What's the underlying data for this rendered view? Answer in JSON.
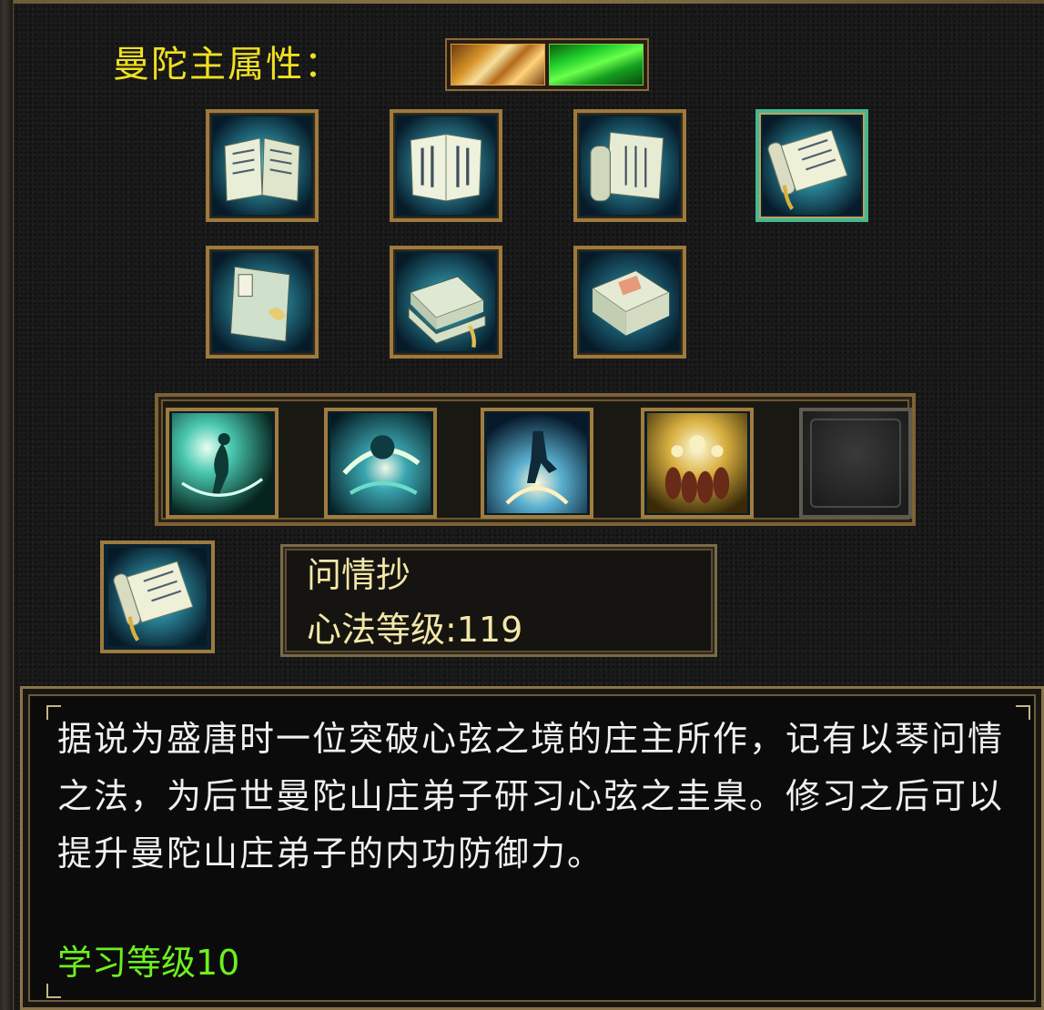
{
  "attributes": {
    "label": "曼陀主属性：",
    "elements": [
      {
        "name": "thunder-element-icon",
        "color": "#d9962a"
      },
      {
        "name": "wood-element-icon",
        "color": "#1fcf2a"
      }
    ]
  },
  "books": [
    {
      "icon": "open-book-icon",
      "selected": false
    },
    {
      "icon": "open-scripture-icon",
      "selected": false
    },
    {
      "icon": "scroll-with-book-icon",
      "selected": false
    },
    {
      "icon": "scroll-icon",
      "selected": true
    },
    {
      "icon": "closed-manual-icon",
      "selected": false
    },
    {
      "icon": "stacked-books-icon",
      "selected": false
    },
    {
      "icon": "boxed-book-icon",
      "selected": false
    }
  ],
  "skills": [
    {
      "icon": "wind-spin-skill-icon",
      "empty": false
    },
    {
      "icon": "wave-slash-skill-icon",
      "empty": false
    },
    {
      "icon": "leap-burst-skill-icon",
      "empty": false
    },
    {
      "icon": "flame-summon-skill-icon",
      "empty": false
    },
    {
      "icon": "empty-skill-slot-icon",
      "empty": true
    }
  ],
  "selected": {
    "icon": "scroll-icon",
    "name": "问情抄",
    "level_text": "心法等级:119"
  },
  "description": {
    "text": "据说为盛唐时一位突破心弦之境的庄主所作，记有以琴问情之法，为后世曼陀山庄弟子研习心弦之圭臬。修习之后可以提升曼陀山庄弟子的内功防御力。",
    "learn_level": "学习等级10"
  },
  "colors": {
    "gold_text": "#f0e020",
    "info_text": "#f3e7a8",
    "learn_green": "#6cf020",
    "frame_gold": "#9d7a3e"
  }
}
